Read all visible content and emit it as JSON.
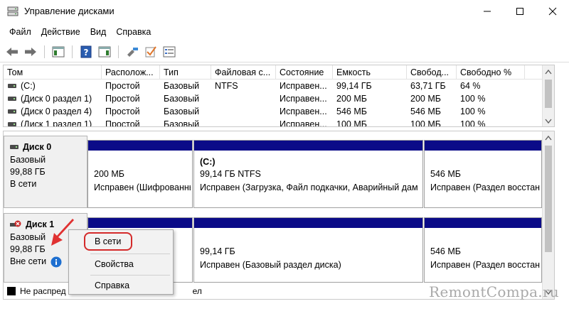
{
  "window": {
    "title": "Управление дисками"
  },
  "menu": [
    "Файл",
    "Действие",
    "Вид",
    "Справка"
  ],
  "columns": [
    "Том",
    "Располож...",
    "Тип",
    "Файловая с...",
    "Состояние",
    "Емкость",
    "Свобод...",
    "Свободно %"
  ],
  "volumes": [
    {
      "name": "(C:)",
      "layout": "Простой",
      "type": "Базовый",
      "fs": "NTFS",
      "status": "Исправен...",
      "capacity": "99,14 ГБ",
      "free": "63,71 ГБ",
      "free_pct": "64 %"
    },
    {
      "name": "(Диск 0 раздел 1)",
      "layout": "Простой",
      "type": "Базовый",
      "fs": "",
      "status": "Исправен...",
      "capacity": "200 МБ",
      "free": "200 МБ",
      "free_pct": "100 %"
    },
    {
      "name": "(Диск 0 раздел 4)",
      "layout": "Простой",
      "type": "Базовый",
      "fs": "",
      "status": "Исправен...",
      "capacity": "546 МБ",
      "free": "546 МБ",
      "free_pct": "100 %"
    },
    {
      "name": "(Диск 1 раздел 1)",
      "layout": "Простой",
      "type": "Базовый",
      "fs": "",
      "status": "Исправен...",
      "capacity": "100 МБ",
      "free": "100 МБ",
      "free_pct": "100 %"
    }
  ],
  "disks": [
    {
      "name": "Диск 0",
      "type": "Базовый",
      "size": "99,88 ГБ",
      "state": "В сети",
      "icon": "disk-icon",
      "partitions": [
        {
          "label": "",
          "size": "200 МБ",
          "status": "Исправен (Шифрованный"
        },
        {
          "label": "(C:)",
          "size": "99,14 ГБ NTFS",
          "status": "Исправен (Загрузка, Файл подкачки, Аварийный дам"
        },
        {
          "label": "",
          "size": "546 МБ",
          "status": "Исправен (Раздел восстанов"
        }
      ]
    },
    {
      "name": "Диск 1",
      "type": "Базовый",
      "size": "99,88 ГБ",
      "state": "Вне сети",
      "icon": "disk-offline-icon",
      "partitions": [
        {
          "label": "",
          "size": "",
          "status": ""
        },
        {
          "label": "",
          "size": "99,14 ГБ",
          "status": "Исправен (Базовый раздел диска)"
        },
        {
          "label": "",
          "size": "546 МБ",
          "status": "Исправен (Раздел восстанов"
        }
      ]
    }
  ],
  "legend": {
    "unallocated_visible": "Не распред",
    "primary_tail": "ел"
  },
  "context_menu": [
    "В сети",
    "Свойства",
    "Справка"
  ],
  "watermark": "RemontCompa.ru",
  "colors": {
    "partition_bar": "#0b0b88",
    "highlight": "#d42a2a",
    "info_icon": "#1e6fd0"
  }
}
